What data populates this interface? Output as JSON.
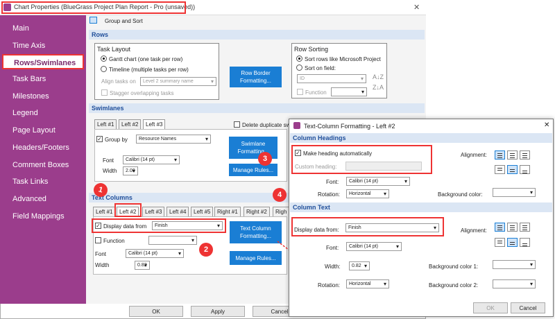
{
  "window": {
    "title": "Chart Properties (BlueGrass Project Plan Report - Pro (unsaved))",
    "close": "✕"
  },
  "sidebar": {
    "items": [
      {
        "label": "Main"
      },
      {
        "label": "Time Axis"
      },
      {
        "label": "Rows/Swimlanes"
      },
      {
        "label": "Task Bars"
      },
      {
        "label": "Milestones"
      },
      {
        "label": "Legend"
      },
      {
        "label": "Page Layout"
      },
      {
        "label": "Headers/Footers"
      },
      {
        "label": "Comment Boxes"
      },
      {
        "label": "Task Links"
      },
      {
        "label": "Advanced"
      },
      {
        "label": "Field Mappings"
      }
    ]
  },
  "toolbar": {
    "group_sort": "Group and Sort"
  },
  "rows": {
    "header": "Rows",
    "task_layout": {
      "title": "Task Layout",
      "gantt": "Gantt chart (one task per row)",
      "timeline": "Timeline (multiple tasks per row)",
      "align_label": "Align tasks on",
      "align_value": "Level 2 summary name",
      "stagger": "Stagger overlapping tasks"
    },
    "border_btn": "Row Border Formatting...",
    "sorting": {
      "title": "Row Sorting",
      "like_project": "Sort rows like Microsoft Project",
      "on_field": "Sort on field:",
      "field_value": "ID",
      "function": "Function"
    }
  },
  "swimlanes": {
    "header": "Swimlanes",
    "tabs": [
      "Left #1",
      "Left #2",
      "Left #3"
    ],
    "delete_dup": "Delete duplicate sw",
    "group_by": "Group by",
    "group_value": "Resource Names",
    "font_label": "Font",
    "font_value": "Calibri (14 pt)",
    "width_label": "Width",
    "width_value": "2.00",
    "format_btn": "Swimlane Formatting...",
    "rules_btn": "Manage Rules..."
  },
  "text_columns": {
    "header": "Text Columns",
    "tabs": [
      "Left #1",
      "Left #2",
      "Left #3",
      "Left #4",
      "Left #5",
      "Right #1",
      "Right #2",
      "Righ"
    ],
    "display_label": "Display data from",
    "display_value": "Finish",
    "function": "Function",
    "font_label": "Font",
    "font_value": "Calibri (14 pt)",
    "width_label": "Width",
    "width_value": "0.82",
    "format_btn": "Text Column Formatting...",
    "rules_btn": "Manage Rules..."
  },
  "footer": {
    "ok": "OK",
    "apply": "Apply",
    "cancel": "Cancel"
  },
  "dialog": {
    "title": "Text-Column Formatting - Left #2",
    "close": "✕",
    "headings": {
      "header": "Column Headings",
      "make_auto": "Make heading automatically",
      "custom_label": "Custom heading:",
      "alignment": "Alignment:",
      "font_label": "Font:",
      "font_value": "Calibri (14 pt)",
      "rotation_label": "Rotation:",
      "rotation_value": "Horizontal",
      "bg_label": "Background color:"
    },
    "text": {
      "header": "Column Text",
      "display_label": "Display data from:",
      "display_value": "Finish",
      "alignment": "Alignment:",
      "font_label": "Font:",
      "font_value": "Calibri (14 pt)",
      "width_label": "Width:",
      "width_value": "0.82",
      "rotation_label": "Rotation:",
      "rotation_value": "Horizontal",
      "bg1_label": "Background color 1:",
      "bg2_label": "Background color 2:"
    },
    "ok": "OK",
    "cancel": "Cancel"
  },
  "callouts": [
    "1",
    "2",
    "3",
    "4"
  ],
  "colors": {
    "sidebar": "#9b3d8c",
    "accent_blue": "#1a7ed4",
    "highlight_red": "#e33"
  }
}
